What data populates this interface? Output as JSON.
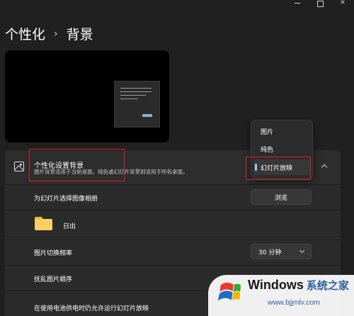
{
  "breadcrumb": {
    "parent": "个性化",
    "separator": "›",
    "current": "背景"
  },
  "background_setting": {
    "title": "个性化设置背景",
    "description": "图片背景适用于当前桌面。纯色或幻灯片背景则适用于所有桌面。"
  },
  "dropdown": {
    "options": [
      "图片",
      "纯色",
      "幻灯片放映"
    ],
    "selected": "幻灯片放映"
  },
  "rows": {
    "album": {
      "label": "为幻灯片选择图像相册",
      "button": "浏览"
    },
    "folder": {
      "name": "日出"
    },
    "interval": {
      "label": "图片切换频率",
      "value": "30 分钟"
    },
    "shuffle": {
      "label": "抚乱图片顺序"
    },
    "battery": {
      "label": "在使用电池供电时仍允许运行幻灯片放映"
    }
  },
  "watermark": {
    "brand": "Windows",
    "brand_cn": "系统之家",
    "url": "www.bjjmlv.com"
  },
  "colors": {
    "background": "#202020",
    "card": "#2b2b2b",
    "accent": "#9fd0f0",
    "highlight": "#e02020"
  }
}
